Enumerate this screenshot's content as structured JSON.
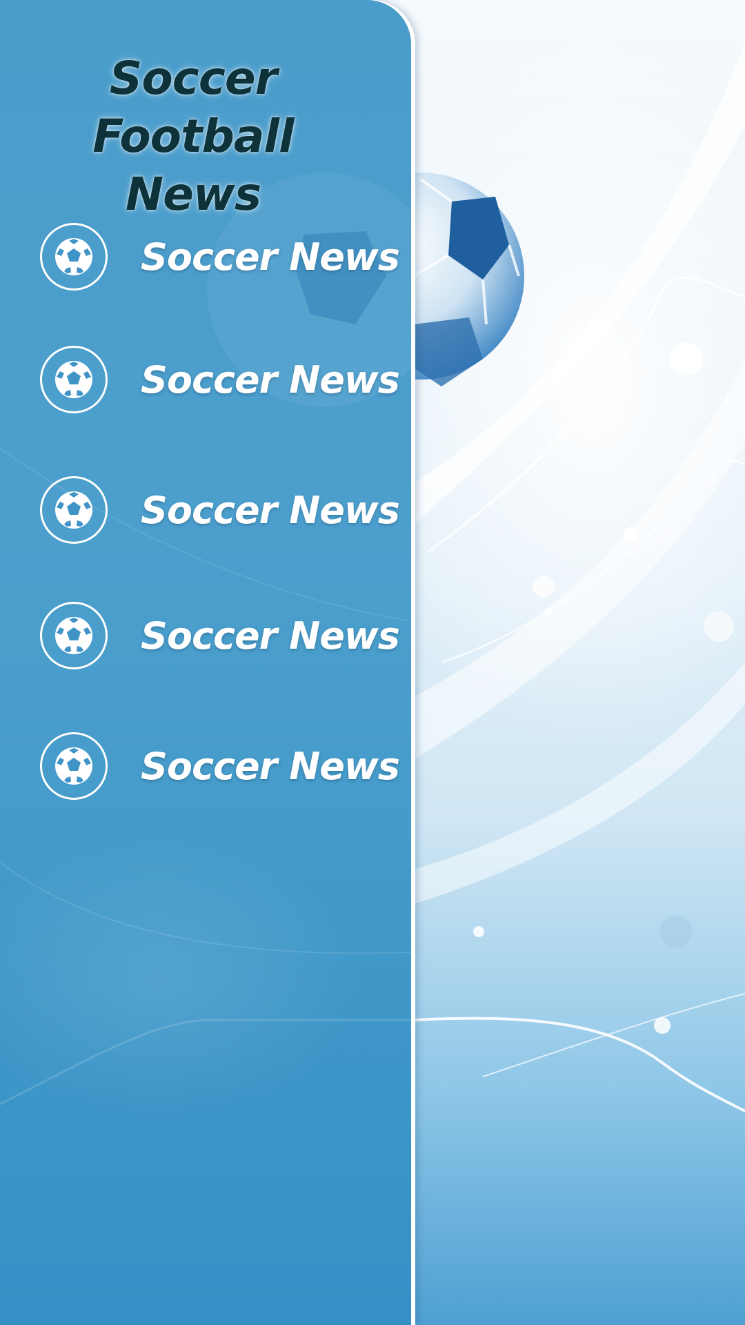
{
  "app": {
    "title_line1": "Soccer Football",
    "title_line2": "News"
  },
  "menu": {
    "items": [
      {
        "label": "Soccer News",
        "icon": "soccer-ball-icon"
      },
      {
        "label": "Soccer News",
        "icon": "soccer-ball-icon"
      },
      {
        "label": "Soccer News",
        "icon": "soccer-ball-icon"
      },
      {
        "label": "Soccer News",
        "icon": "soccer-ball-icon"
      },
      {
        "label": "Soccer News",
        "icon": "soccer-ball-icon"
      }
    ]
  },
  "colors": {
    "panel": "#4a9ccb",
    "title_text": "#0d3239",
    "menu_text": "#ffffff"
  }
}
